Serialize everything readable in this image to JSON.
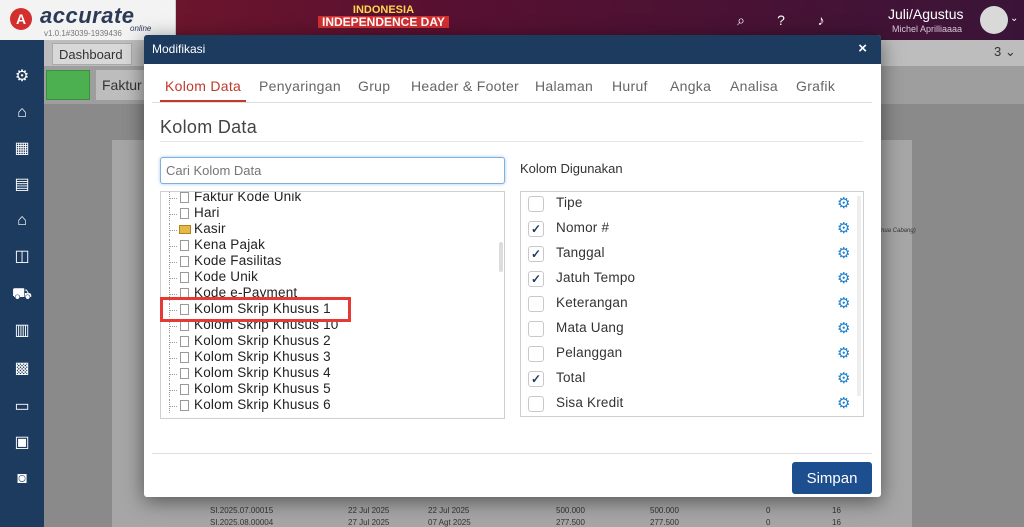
{
  "app": {
    "logo_text": "accurate",
    "logo_suffix": "online",
    "version": "v1.0.1#3039-1939436",
    "banner_line1": "INDONESIA",
    "banner_line2": "INDEPENDENCE DAY",
    "period": "Juli/Agustus",
    "user_name": "Michel Aprilliaaaa"
  },
  "background": {
    "tab_dashboard": "Dashboard",
    "tab_count": "3 ⌄",
    "faktur_tab": "Faktur",
    "side_note": "emua Cabang)",
    "rows": [
      {
        "no": "SI.2025.07.00015",
        "date1": "22 Jul 2025",
        "date2": "22 Jul 2025",
        "amt1": "500.000",
        "amt2": "500.000",
        "c1": "0",
        "c2": "16"
      },
      {
        "no": "SI.2025.08.00004",
        "date1": "27 Jul 2025",
        "date2": "07 Agt 2025",
        "amt1": "277.500",
        "amt2": "277.500",
        "c1": "0",
        "c2": "16"
      }
    ]
  },
  "modal": {
    "title": "Modifikasi",
    "close": "×",
    "tabs": [
      "Kolom Data",
      "Penyaringan",
      "Grup",
      "Header & Footer",
      "Halaman",
      "Huruf",
      "Angka",
      "Analisa",
      "Grafik"
    ],
    "active_tab": "Kolom Data",
    "section_title": "Kolom Data",
    "search_placeholder": "Cari Kolom Data",
    "tree_items": [
      {
        "label": "Faktur Kode Unik",
        "icon": "file"
      },
      {
        "label": "Hari",
        "icon": "file"
      },
      {
        "label": "Kasir",
        "icon": "folder"
      },
      {
        "label": "Kena Pajak",
        "icon": "file"
      },
      {
        "label": "Kode Fasilitas",
        "icon": "file"
      },
      {
        "label": "Kode Unik",
        "icon": "file"
      },
      {
        "label": "Kode e-Payment",
        "icon": "file"
      },
      {
        "label": "Kolom Skrip Khusus 1",
        "icon": "file",
        "highlighted": true
      },
      {
        "label": "Kolom Skrip Khusus 10",
        "icon": "file"
      },
      {
        "label": "Kolom Skrip Khusus 2",
        "icon": "file"
      },
      {
        "label": "Kolom Skrip Khusus 3",
        "icon": "file"
      },
      {
        "label": "Kolom Skrip Khusus 4",
        "icon": "file"
      },
      {
        "label": "Kolom Skrip Khusus 5",
        "icon": "file"
      },
      {
        "label": "Kolom Skrip Khusus 6",
        "icon": "file"
      }
    ],
    "used_label": "Kolom Digunakan",
    "used_columns": [
      {
        "label": "Tipe",
        "checked": false
      },
      {
        "label": "Nomor #",
        "checked": true
      },
      {
        "label": "Tanggal",
        "checked": true
      },
      {
        "label": "Jatuh Tempo",
        "checked": true
      },
      {
        "label": "Keterangan",
        "checked": false
      },
      {
        "label": "Mata Uang",
        "checked": false
      },
      {
        "label": "Pelanggan",
        "checked": false
      },
      {
        "label": "Total",
        "checked": true
      },
      {
        "label": "Sisa Kredit",
        "checked": false
      }
    ],
    "save_label": "Simpan"
  },
  "colors": {
    "header_navy": "#1d3a5f",
    "active_tab_red": "#c0392b",
    "highlight_red": "#e53935",
    "gear_blue": "#1e7fc8",
    "save_blue": "#1d4e8f"
  }
}
